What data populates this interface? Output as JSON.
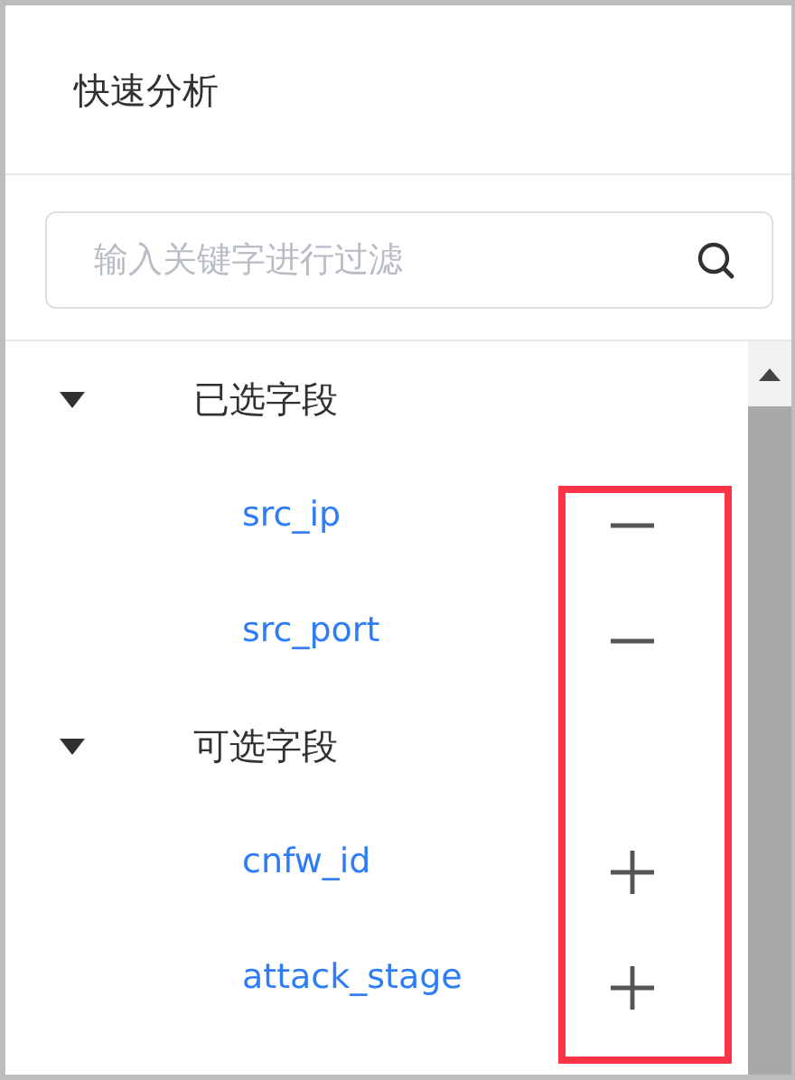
{
  "panel": {
    "title": "快速分析"
  },
  "search": {
    "placeholder": "输入关键字进行过滤"
  },
  "groups": [
    {
      "label": "已选字段",
      "expanded": true,
      "children": [
        {
          "label": "src_ip",
          "kind": "remove"
        },
        {
          "label": "src_port",
          "kind": "remove"
        }
      ]
    },
    {
      "label": "可选字段",
      "expanded": true,
      "children": [
        {
          "label": "cnfw_id",
          "kind": "add"
        },
        {
          "label": "attack_stage",
          "kind": "add"
        }
      ]
    }
  ],
  "highlight_box": true
}
